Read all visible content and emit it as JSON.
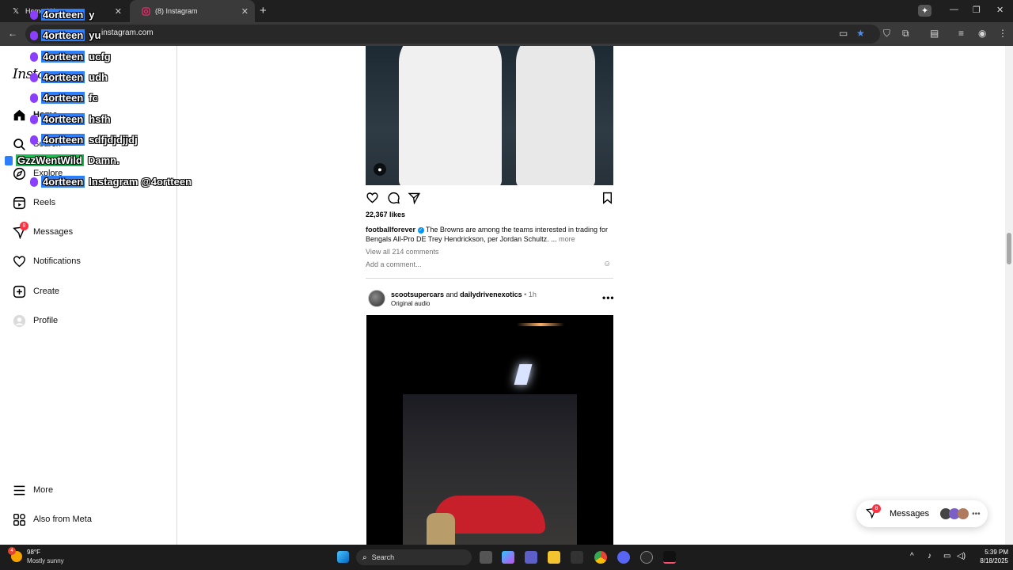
{
  "browser": {
    "tabs": [
      {
        "title": "Home / X",
        "icon": "x-logo-icon"
      },
      {
        "title": "(8) Instagram",
        "icon": "instagram-icon"
      }
    ],
    "url": "instagram.com"
  },
  "sidebar": {
    "logo": "Instagram",
    "items": [
      {
        "label": "Home",
        "icon": "home-icon"
      },
      {
        "label": "Search",
        "icon": "search-icon"
      },
      {
        "label": "Explore",
        "icon": "compass-icon"
      },
      {
        "label": "Reels",
        "icon": "reels-icon"
      },
      {
        "label": "Messages",
        "icon": "messenger-icon",
        "badge": "8"
      },
      {
        "label": "Notifications",
        "icon": "heart-icon"
      },
      {
        "label": "Create",
        "icon": "plus-square-icon"
      },
      {
        "label": "Profile",
        "icon": "avatar-icon"
      }
    ],
    "bottom": [
      {
        "label": "More",
        "icon": "menu-icon"
      },
      {
        "label": "Also from Meta",
        "icon": "meta-apps-icon"
      }
    ]
  },
  "post1": {
    "likes": "22,367 likes",
    "author": "footballforever",
    "caption": "The Browns are among the teams interested in trading for Bengals All-Pro DE Trey Hendrickson, per Jordan Schultz. ...",
    "more": "more",
    "view_comments": "View all 214 comments",
    "add_comment_placeholder": "Add a comment..."
  },
  "post2": {
    "author1": "scootsupercars",
    "joiner": "and",
    "author2": "dailydrivenexotics",
    "time": "• 1h",
    "audio": "Original audio"
  },
  "messages_pill": {
    "label": "Messages",
    "badge": "8"
  },
  "chat_overlay": [
    {
      "name": "4ortteen",
      "text": "y"
    },
    {
      "name": "4ortteen",
      "text": "yu"
    },
    {
      "name": "4ortteen",
      "text": "ucfg"
    },
    {
      "name": "4ortteen",
      "text": "udh"
    },
    {
      "name": "4ortteen",
      "text": "fc"
    },
    {
      "name": "4ortteen",
      "text": "hsfh"
    },
    {
      "name": "4ortteen",
      "text": "sdfjdjdjjdj"
    },
    {
      "name": "GzzWentWild",
      "text": "Damn."
    },
    {
      "name": "4ortteen",
      "text": "Instagram @4ortteen"
    }
  ],
  "taskbar": {
    "weather_temp": "98°F",
    "weather_desc": "Mostly sunny",
    "weather_badge": "4",
    "search_label": "Search",
    "time": "5:39 PM",
    "date": "8/18/2025"
  },
  "colors": {
    "accent_blue": "#0095f6",
    "badge_red": "#ff3040",
    "chat_name_blue": "#2d7ff9",
    "chat_name_green": "#1db954"
  }
}
